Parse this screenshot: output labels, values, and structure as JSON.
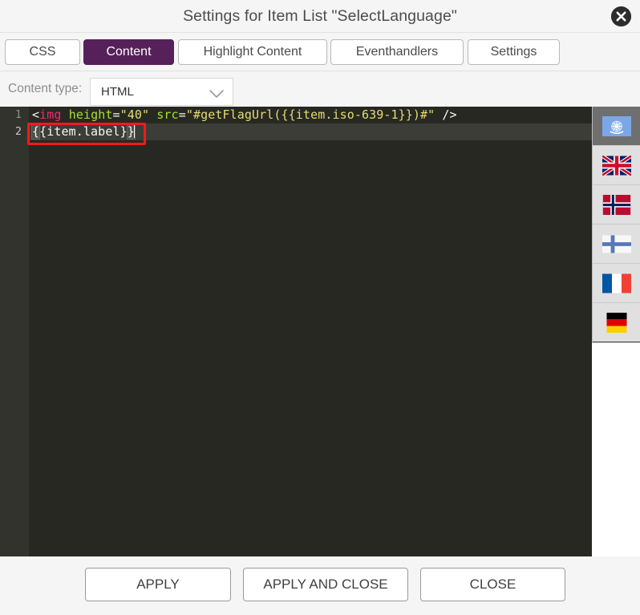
{
  "window": {
    "title": "Settings for Item List \"SelectLanguage\"",
    "close_icon": "close-circle-icon"
  },
  "tabs": [
    {
      "id": "css",
      "label": "CSS",
      "active": false
    },
    {
      "id": "content",
      "label": "Content",
      "active": true
    },
    {
      "id": "highlight",
      "label": "Highlight Content",
      "active": false
    },
    {
      "id": "events",
      "label": "Eventhandlers",
      "active": false
    },
    {
      "id": "settings",
      "label": "Settings",
      "active": false
    }
  ],
  "content_type": {
    "label": "Content type:",
    "value": "HTML",
    "chevron_icon": "chevron-down-icon",
    "options": [
      "HTML"
    ]
  },
  "editor": {
    "language": "html",
    "line_numbers": [
      "1",
      "2"
    ],
    "active_line": 2,
    "lines": [
      {
        "number": "1",
        "text": "<img height=\"40\" src=\"#getFlagUrl({{item.iso-639-1}})#\" />",
        "tokens": [
          {
            "t": "<",
            "k": "punc"
          },
          {
            "t": "img",
            "k": "tag"
          },
          {
            "t": " ",
            "k": "plain"
          },
          {
            "t": "height",
            "k": "attr"
          },
          {
            "t": "=",
            "k": "eq"
          },
          {
            "t": "\"40\"",
            "k": "str"
          },
          {
            "t": " ",
            "k": "plain"
          },
          {
            "t": "src",
            "k": "attr"
          },
          {
            "t": "=",
            "k": "eq"
          },
          {
            "t": "\"#getFlagUrl({{item.iso-639-1}})#\"",
            "k": "str"
          },
          {
            "t": " />",
            "k": "punc"
          }
        ]
      },
      {
        "number": "2",
        "text": "{{item.label}}",
        "tokens": [
          {
            "t": "{",
            "k": "match"
          },
          {
            "t": "{item.label}",
            "k": "plain"
          },
          {
            "t": "}",
            "k": "match"
          }
        ]
      }
    ]
  },
  "annotation": {
    "kind": "red-rectangle-highlight",
    "target_text": "{{item.label}}",
    "color": "#f01b1b"
  },
  "flag_panel": {
    "items": [
      {
        "id": "un",
        "name": "un-flag",
        "label": "UN",
        "selected": true
      },
      {
        "id": "gb",
        "name": "uk-flag",
        "label": "United Kingdom",
        "selected": false
      },
      {
        "id": "no",
        "name": "norway-flag",
        "label": "Norway",
        "selected": false
      },
      {
        "id": "fi",
        "name": "finland-flag",
        "label": "Finland",
        "selected": false
      },
      {
        "id": "fr",
        "name": "france-flag",
        "label": "France",
        "selected": false
      },
      {
        "id": "de",
        "name": "germany-flag",
        "label": "Germany",
        "selected": false
      }
    ]
  },
  "footer": {
    "apply": "APPLY",
    "apply_and_close": "APPLY AND CLOSE",
    "close": "CLOSE"
  },
  "colors": {
    "accent_purple": "#56205a",
    "annotation_red": "#f01b1b",
    "editor_bg": "#272822",
    "editor_gutter": "#32332c",
    "active_line": "#3c3d37",
    "chrome_bg": "#f5f5f5",
    "syntax_tag": "#f92672",
    "syntax_attr": "#a6e22e",
    "syntax_string": "#e6db74",
    "syntax_text": "#f8f8f2"
  }
}
